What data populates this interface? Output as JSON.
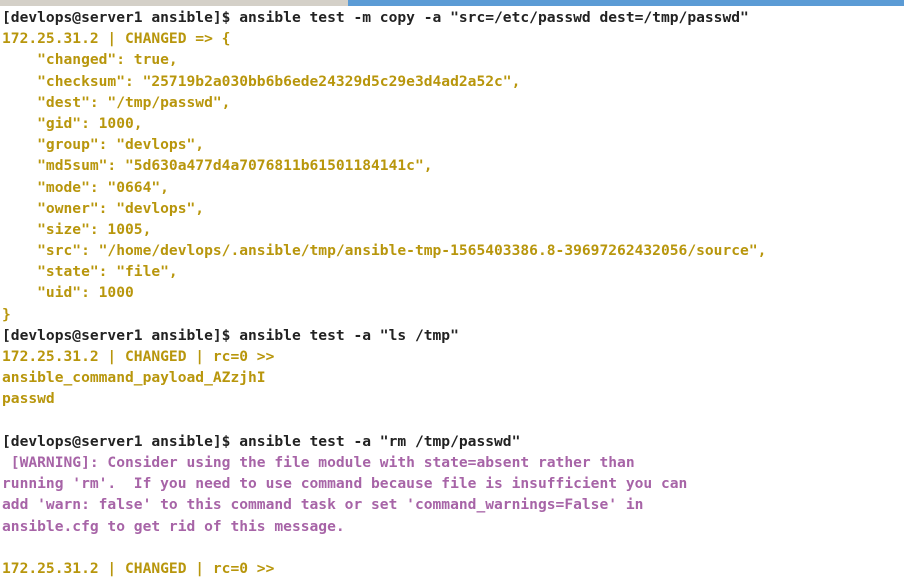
{
  "window": {
    "type": "terminal-emulator",
    "background_color": "#ffffff",
    "scrollbar": {
      "name": "horizontal-scrollbar",
      "track_color": "#d4d0c8",
      "thumb_color": "#5b9bd5",
      "thumb_start_percent": 38.5,
      "thumb_end_percent": 100
    }
  },
  "colors": {
    "prompt": "#222222",
    "ok_changed": "#b8960c",
    "warning": "#a764a7"
  },
  "terminal": {
    "prompt": "[devlops@server1 ansible]$",
    "host": "devlops@server1",
    "cwd": "ansible",
    "target_host": "172.25.31.2",
    "lines": [
      {
        "text": "[devlops@server1 ansible]$ ansible test -m copy -a \"src=/etc/passwd dest=/tmp/passwd\"",
        "color": "prompt"
      },
      {
        "text": "172.25.31.2 | CHANGED => {",
        "color": "gold"
      },
      {
        "text": "    \"changed\": true,",
        "color": "gold"
      },
      {
        "text": "    \"checksum\": \"25719b2a030bb6b6ede24329d5c29e3d4ad2a52c\",",
        "color": "gold"
      },
      {
        "text": "    \"dest\": \"/tmp/passwd\",",
        "color": "gold"
      },
      {
        "text": "    \"gid\": 1000,",
        "color": "gold"
      },
      {
        "text": "    \"group\": \"devlops\",",
        "color": "gold"
      },
      {
        "text": "    \"md5sum\": \"5d630a477d4a7076811b61501184141c\",",
        "color": "gold"
      },
      {
        "text": "    \"mode\": \"0664\",",
        "color": "gold"
      },
      {
        "text": "    \"owner\": \"devlops\",",
        "color": "gold"
      },
      {
        "text": "    \"size\": 1005,",
        "color": "gold"
      },
      {
        "text": "    \"src\": \"/home/devlops/.ansible/tmp/ansible-tmp-1565403386.8-39697262432056/source\",",
        "color": "gold"
      },
      {
        "text": "    \"state\": \"file\",",
        "color": "gold"
      },
      {
        "text": "    \"uid\": 1000",
        "color": "gold"
      },
      {
        "text": "}",
        "color": "gold"
      },
      {
        "text": "[devlops@server1 ansible]$ ansible test -a \"ls /tmp\"",
        "color": "prompt"
      },
      {
        "text": "172.25.31.2 | CHANGED | rc=0 >>",
        "color": "gold"
      },
      {
        "text": "ansible_command_payload_AZzjhI",
        "color": "gold"
      },
      {
        "text": "passwd",
        "color": "gold"
      },
      {
        "text": "",
        "color": "blank"
      },
      {
        "text": "[devlops@server1 ansible]$ ansible test -a \"rm /tmp/passwd\"",
        "color": "prompt"
      },
      {
        "text": " [WARNING]: Consider using the file module with state=absent rather than",
        "color": "warn"
      },
      {
        "text": "running 'rm'.  If you need to use command because file is insufficient you can",
        "color": "warn"
      },
      {
        "text": "add 'warn: false' to this command task or set 'command_warnings=False' in",
        "color": "warn"
      },
      {
        "text": "ansible.cfg to get rid of this message.",
        "color": "warn"
      },
      {
        "text": "",
        "color": "blank"
      },
      {
        "text": "172.25.31.2 | CHANGED | rc=0 >>",
        "color": "gold"
      }
    ],
    "commands": [
      "ansible test -m copy -a \"src=/etc/passwd dest=/tmp/passwd\"",
      "ansible test -a \"ls /tmp\"",
      "ansible test -a \"rm /tmp/passwd\""
    ],
    "copy_result": {
      "host": "172.25.31.2",
      "status": "CHANGED",
      "changed": "true",
      "checksum": "25719b2a030bb6b6ede24329d5c29e3d4ad2a52c",
      "dest": "/tmp/passwd",
      "gid": "1000",
      "group": "devlops",
      "md5sum": "5d630a477d4a7076811b61501184141c",
      "mode": "0664",
      "owner": "devlops",
      "size": "1005",
      "src": "/home/devlops/.ansible/tmp/ansible-tmp-1565403386.8-39697262432056/source",
      "state": "file",
      "uid": "1000"
    },
    "ls_result": {
      "header": "172.25.31.2 | CHANGED | rc=0 >>",
      "entries": [
        "ansible_command_payload_AZzjhI",
        "passwd"
      ]
    },
    "rm_result": {
      "warning_label": "[WARNING]:",
      "warning_text": "Consider using the file module with state=absent rather than running 'rm'.  If you need to use command because file is insufficient you can add 'warn: false' to this command task or set 'command_warnings=False' in ansible.cfg to get rid of this message.",
      "header": "172.25.31.2 | CHANGED | rc=0 >>"
    }
  }
}
